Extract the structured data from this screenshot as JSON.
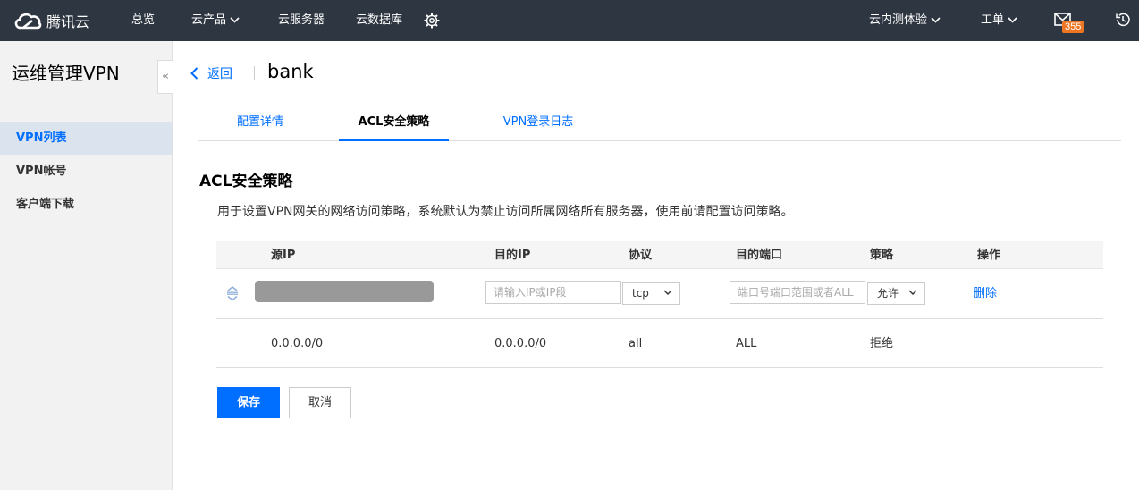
{
  "topbar": {
    "logo_text": "腾讯云",
    "nav": {
      "overview": "总览",
      "products": "云产品",
      "cvm": "云服务器",
      "cdb": "云数据库",
      "beta": "云内测体验",
      "ticket": "工单"
    },
    "mail_badge": "355"
  },
  "sidebar": {
    "title": "运维管理VPN",
    "items": [
      {
        "label": "VPN列表",
        "active": true
      },
      {
        "label": "VPN帐号",
        "active": false
      },
      {
        "label": "客户端下载",
        "active": false
      }
    ],
    "collapse_glyph": "«"
  },
  "header": {
    "back_label": "返回",
    "title": "bank"
  },
  "tabs": [
    {
      "label": "配置详情",
      "active": false
    },
    {
      "label": "ACL安全策略",
      "active": true
    },
    {
      "label": "VPN登录日志",
      "active": false
    }
  ],
  "section": {
    "title": "ACL安全策略",
    "description": "用于设置VPN网关的网络访问策略，系统默认为禁止访问所属网络所有服务器，使用前请配置访问策略。"
  },
  "table": {
    "columns": [
      "源IP",
      "目的IP",
      "协议",
      "目的端口",
      "策略",
      "操作"
    ],
    "edit_row": {
      "dest_ip_placeholder": "请输入IP或IP段",
      "protocol": "tcp",
      "port_placeholder": "端口号端口范围或者ALL",
      "policy": "允许",
      "action": "删除"
    },
    "default_row": {
      "src_ip": "0.0.0.0/0",
      "dest_ip": "0.0.0.0/0",
      "protocol": "all",
      "port": "ALL",
      "policy": "拒绝"
    }
  },
  "buttons": {
    "save": "保存",
    "cancel": "取消"
  },
  "colors": {
    "topbar": "#2e3641",
    "accent": "#006eff",
    "badge": "#ee7623"
  }
}
